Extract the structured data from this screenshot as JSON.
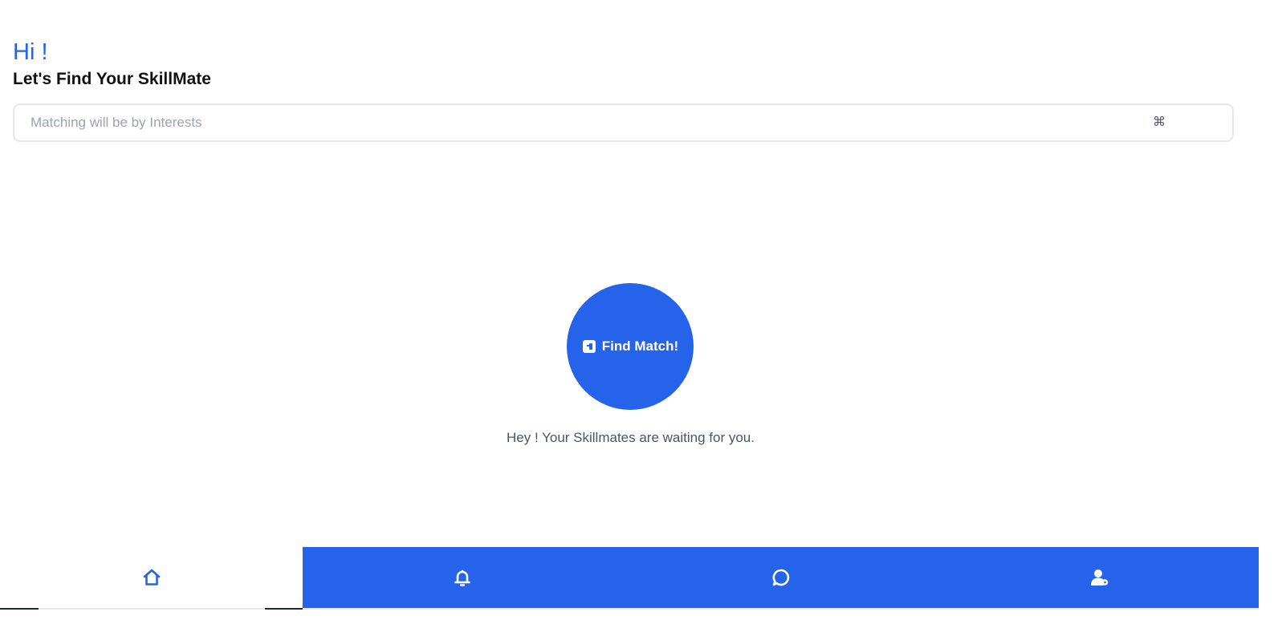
{
  "header": {
    "greeting": "Hi !",
    "subtitle": "Let's Find Your SkillMate"
  },
  "search": {
    "placeholder": "Matching will be by Interests",
    "value": "",
    "shortcut_icon": "⌘"
  },
  "match": {
    "button_label": "Find Match!",
    "icon": "match-square-icon",
    "waiting_message": "Hey ! Your Skillmates are waiting for you."
  },
  "bottom_nav": {
    "items": [
      {
        "icon": "home-icon",
        "active": true
      },
      {
        "icon": "bell-icon",
        "active": false
      },
      {
        "icon": "chat-icon",
        "active": false
      },
      {
        "icon": "profile-icon",
        "active": false
      }
    ]
  },
  "colors": {
    "accent": "#2563eb",
    "text_dark": "#111111",
    "text_muted": "#4b5563",
    "placeholder": "#9ca3af",
    "border": "#e5e7eb",
    "background": "#ffffff"
  }
}
